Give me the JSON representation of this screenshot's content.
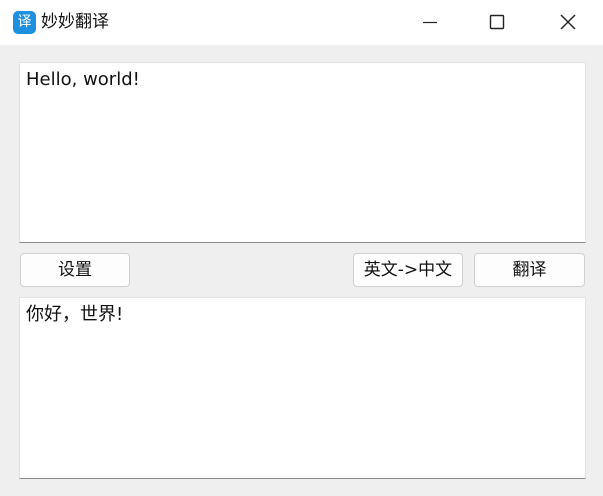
{
  "window": {
    "icon_glyph": "译",
    "title": "妙妙翻译",
    "minimize_icon": "minimize-icon",
    "maximize_icon": "maximize-icon",
    "close_icon": "close-icon",
    "accent_color": "#1e90e0"
  },
  "input": {
    "value": "Hello, world!"
  },
  "toolbar": {
    "settings_label": "设置",
    "direction_label": "英文->中文",
    "translate_label": "翻译"
  },
  "output": {
    "value": "你好，世界!"
  }
}
